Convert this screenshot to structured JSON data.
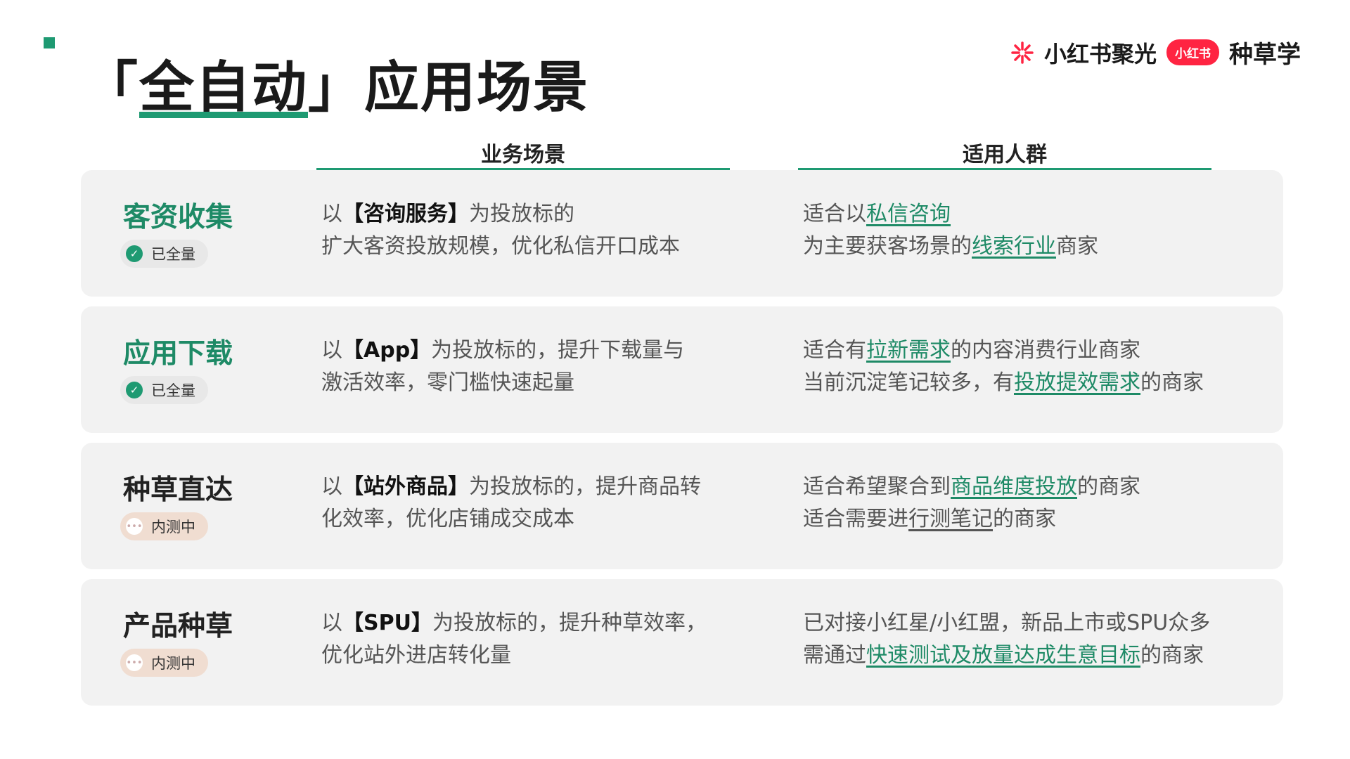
{
  "title": {
    "open": "「",
    "highlight": "全自动",
    "close": "」",
    "rest": "应用场景"
  },
  "brand": {
    "name": "小红书聚光",
    "badge": "小红书",
    "sub": "种草学"
  },
  "columns": {
    "business": "业务场景",
    "audience": "适用人群"
  },
  "rows": [
    {
      "name": "客资收集",
      "status": "已全量",
      "status_icon": "check-icon",
      "biz": {
        "pre": "以",
        "target": "【咨询服务】",
        "post": "为投放标的",
        "line2": "扩大客资投放规模，优化私信开口成本"
      },
      "aud": {
        "l1a": "适合以",
        "l1link": "私信咨询",
        "l2a": "为主要获客场景的",
        "l2link": "线索行业",
        "l2b": "商家"
      }
    },
    {
      "name": "应用下载",
      "status": "已全量",
      "status_icon": "check-icon",
      "biz": {
        "pre": "以",
        "target": "【App】",
        "post": "为投放标的，提升下载量与",
        "line2": "激活效率，零门槛快速起量"
      },
      "aud": {
        "l1a": "适合有",
        "l1link": "拉新需求",
        "l1b": "的内容消费行业商家",
        "l2a": "当前沉淀笔记较多，有",
        "l2link": "投放提效需求",
        "l2b": "的商家"
      }
    },
    {
      "name": "种草直达",
      "status": "内测中",
      "status_icon": "ellipsis-icon",
      "biz": {
        "pre": "以",
        "target": "【站外商品】",
        "post": "为投放标的，提升商品转",
        "line2": "化效率，优化店铺成交成本"
      },
      "aud": {
        "l1a": "适合希望聚合到",
        "l1link": "商品维度投放",
        "l1b": "的商家",
        "l2a": "适合需要进",
        "l2ul": "行测笔记",
        "l2b": "的商家"
      }
    },
    {
      "name": "产品种草",
      "status": "内测中",
      "status_icon": "ellipsis-icon",
      "biz": {
        "pre": "以",
        "target": "【SPU】",
        "post": "为投放标的，提升种草效率，",
        "line2": "优化站外进店转化量"
      },
      "aud": {
        "l1a": "已对接小红星/小红盟，新品上市或SPU众多",
        "l2a": "需通过",
        "l2link": "快速测试及放量达成生意目标",
        "l2b": "的商家"
      }
    }
  ],
  "colors": {
    "accent": "#1e9a72",
    "brand_red": "#ff2442",
    "row_bg": "#f2f2f2"
  }
}
